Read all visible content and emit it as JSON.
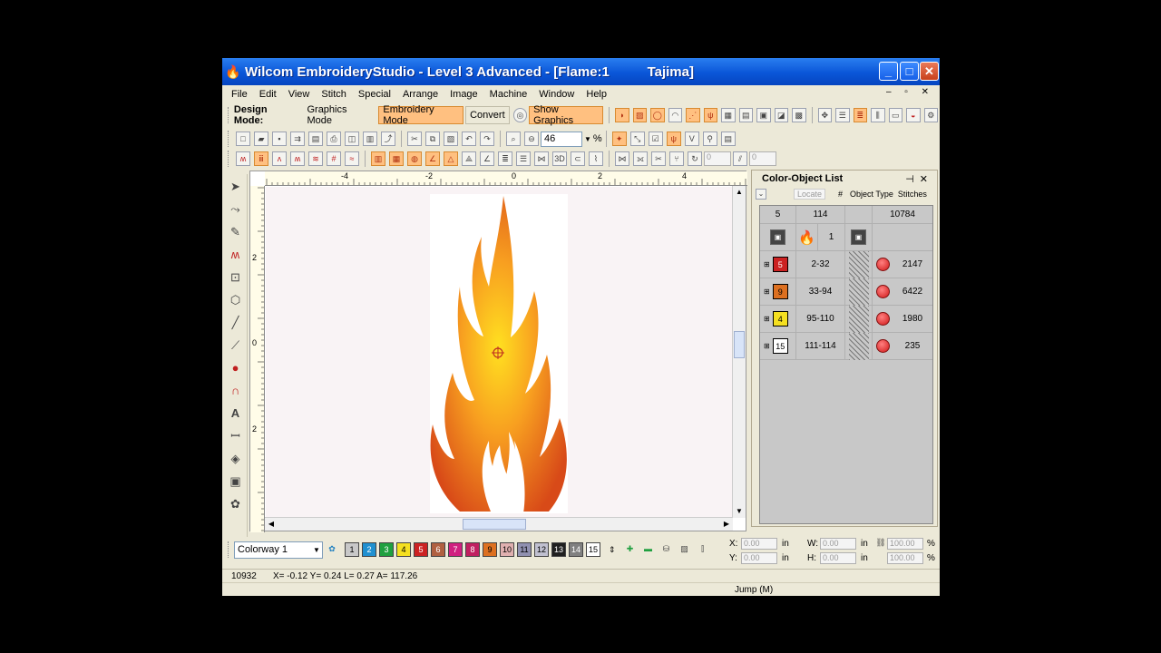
{
  "window": {
    "title": "Wilcom EmbroideryStudio - Level 3 Advanced - [Flame:1          Tajima]",
    "min": "_",
    "max": "□",
    "close": "✕"
  },
  "menu": [
    "File",
    "Edit",
    "View",
    "Stitch",
    "Special",
    "Arrange",
    "Image",
    "Machine",
    "Window",
    "Help"
  ],
  "mdi_buttons": "– ▫ ✕",
  "toolbar1": {
    "design_mode_label": "Design Mode:",
    "graphics_mode": "Graphics Mode",
    "embroidery_mode": "Embroidery Mode",
    "convert": "Convert",
    "show_graphics": "Show Graphics"
  },
  "toolbar2": {
    "zoom_value": "46",
    "zoom_unit": "%",
    "field_a": "0",
    "field_b": "0"
  },
  "panel": {
    "title": "Color-Object List",
    "locate": "Locate",
    "col_num": "#",
    "col_type": "Object Type",
    "col_stitches": "Stitches",
    "summary": {
      "count": "5",
      "objects": "114",
      "stitches": "10784"
    },
    "design_row": {
      "num": "1"
    },
    "rows": [
      {
        "color_num": "5",
        "color": "#cc2222",
        "text_color": "#ffffff",
        "range": "2-32",
        "stitches": "2147"
      },
      {
        "color_num": "9",
        "color": "#dd7020",
        "text_color": "#000000",
        "range": "33-94",
        "stitches": "6422"
      },
      {
        "color_num": "4",
        "color": "#f5e020",
        "text_color": "#000000",
        "range": "95-110",
        "stitches": "1980"
      },
      {
        "color_num": "15",
        "color": "#ffffff",
        "text_color": "#000000",
        "range": "111-114",
        "stitches": "235"
      }
    ]
  },
  "colorway": {
    "label": "Colorway 1",
    "chips": [
      {
        "n": "1",
        "c": "#c8c8c8",
        "t": "#000"
      },
      {
        "n": "2",
        "c": "#2090d0",
        "t": "#fff"
      },
      {
        "n": "3",
        "c": "#20a040",
        "t": "#fff"
      },
      {
        "n": "4",
        "c": "#f5e020",
        "t": "#000"
      },
      {
        "n": "5",
        "c": "#cc2222",
        "t": "#fff"
      },
      {
        "n": "6",
        "c": "#b06040",
        "t": "#fff"
      },
      {
        "n": "7",
        "c": "#d02080",
        "t": "#fff"
      },
      {
        "n": "8",
        "c": "#c02060",
        "t": "#fff"
      },
      {
        "n": "9",
        "c": "#dd7020",
        "t": "#000"
      },
      {
        "n": "10",
        "c": "#e0b0b0",
        "t": "#000"
      },
      {
        "n": "11",
        "c": "#9090b0",
        "t": "#000"
      },
      {
        "n": "12",
        "c": "#c0c0d0",
        "t": "#000"
      },
      {
        "n": "13",
        "c": "#202020",
        "t": "#fff"
      },
      {
        "n": "14",
        "c": "#808080",
        "t": "#fff"
      },
      {
        "n": "15",
        "c": "#ffffff",
        "t": "#000"
      }
    ]
  },
  "coords": {
    "x_label": "X:",
    "y_label": "Y:",
    "w_label": "W:",
    "h_label": "H:",
    "x": "0.00",
    "y": "0.00",
    "w": "0.00",
    "h": "0.00",
    "unit": "in",
    "sx": "100.00",
    "sy": "100.00",
    "pct": "%"
  },
  "status": {
    "stitch": "10932",
    "pos": "X=  -0.12 Y=   0.24 L=   0.27 A= 117.26",
    "mode": "Jump (M)"
  },
  "ruler": {
    "h": [
      "-4",
      "-2",
      "0",
      "2",
      "4"
    ],
    "v": [
      "2",
      "0",
      "2"
    ]
  }
}
